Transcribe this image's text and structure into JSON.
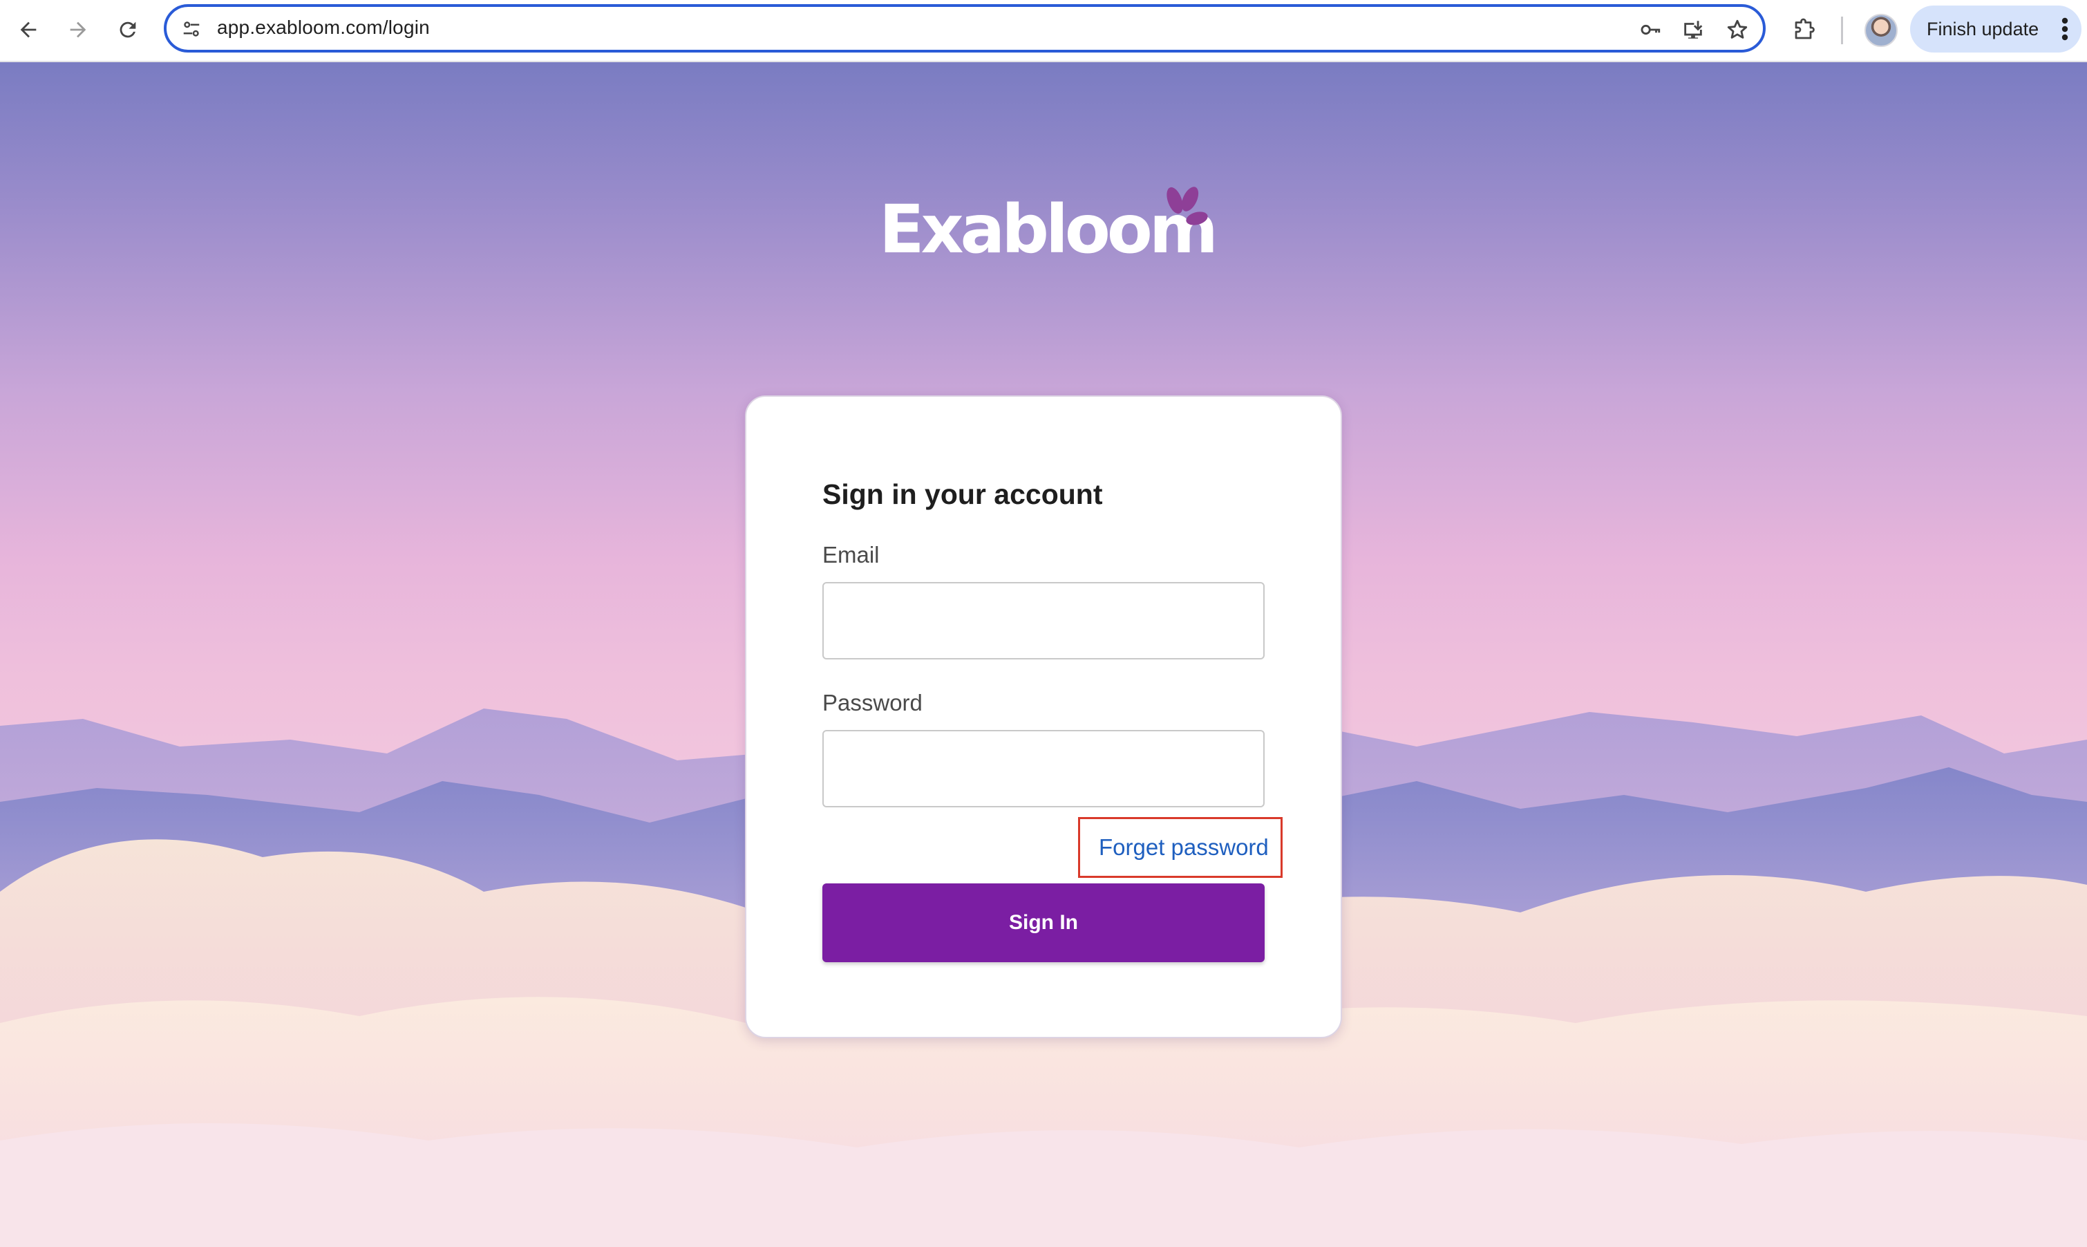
{
  "browser": {
    "url": "app.exabloom.com/login",
    "finish_update_label": "Finish update",
    "icons": {
      "back": "arrow-left-icon",
      "forward": "arrow-right-icon",
      "reload": "reload-icon",
      "site_info": "tune-icon",
      "passwords": "key-icon",
      "install_app": "install-desktop-icon",
      "bookmark": "star-icon",
      "extensions": "puzzle-icon",
      "menu": "kebab-menu-icon"
    },
    "accent_color": "#2a5bd7"
  },
  "brand": {
    "logo_text": "Exabloom",
    "mark_color": "#8e3f97"
  },
  "login": {
    "title": "Sign in your account",
    "email_label": "Email",
    "email_value": "",
    "password_label": "Password",
    "password_value": "",
    "forgot_label": "Forget password",
    "signin_label": "Sign In",
    "button_color": "#7b1ea3",
    "highlight_color": "#d93a2b"
  }
}
